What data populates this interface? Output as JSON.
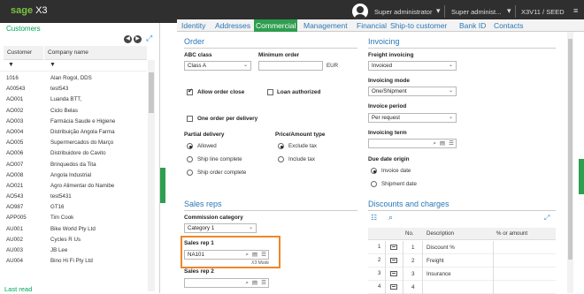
{
  "topbar": {
    "logo_brand": "sage",
    "logo_product": "X3",
    "user_name": "Super administrator",
    "role": "Super administ...",
    "endpoint": "X3V11 / SEED",
    "icons": [
      "user-avatar-icon",
      "caret-down-icon",
      "caret-down-icon",
      "hamburger-menu-icon"
    ]
  },
  "left_panel": {
    "title": "Customers",
    "columns": [
      "Customer",
      "Company name"
    ],
    "rows": [
      {
        "code": "1016",
        "name": "Alan Rogol, DDS"
      },
      {
        "code": "A00543",
        "name": "test543"
      },
      {
        "code": "AO001",
        "name": "Luanda BTT,"
      },
      {
        "code": "AO002",
        "name": "Ciclo Belas"
      },
      {
        "code": "AO003",
        "name": "Farmácia Saude e Higiene"
      },
      {
        "code": "AO004",
        "name": "Distribuição Angola Farma"
      },
      {
        "code": "AO005",
        "name": "Supermercados do Março"
      },
      {
        "code": "AO006",
        "name": "Distribuidore do Cavito"
      },
      {
        "code": "AO007",
        "name": "Brinquedos da Tita"
      },
      {
        "code": "AO008",
        "name": "Angola Industrial"
      },
      {
        "code": "AO021",
        "name": "Agro Alimentar do Namibe"
      },
      {
        "code": "AO543",
        "name": "test5431"
      },
      {
        "code": "AO987",
        "name": "GT16"
      },
      {
        "code": "APP005",
        "name": "Tim Cook"
      },
      {
        "code": "AU001",
        "name": "Bike World Pty Ltd"
      },
      {
        "code": "AU002",
        "name": "Cycles R Us"
      },
      {
        "code": "AU003",
        "name": "JB Lee"
      },
      {
        "code": "AU004",
        "name": "Bino Hi Fi Pty Ltd"
      }
    ],
    "last_read": "Last read"
  },
  "tabs": [
    "Identity",
    "Addresses",
    "Commercial",
    "Management",
    "Financial",
    "Ship-to customer",
    "Bank ID",
    "Contacts"
  ],
  "active_tab": "Commercial",
  "order": {
    "title": "Order",
    "abc_label": "ABC class",
    "abc_value": "Class A",
    "min_order_label": "Minimum order",
    "min_order_value": "",
    "currency": "EUR",
    "allow_close": "Allow order close",
    "allow_close_checked": true,
    "loan_authorized": "Loan authorized",
    "loan_checked": false,
    "one_order": "One order per delivery",
    "one_order_checked": false,
    "partial_label": "Partial delivery",
    "partial_options": [
      "Allowed",
      "Ship line complete",
      "Ship order complete"
    ],
    "partial_selected": "Allowed",
    "price_label": "Price/Amount type",
    "price_options": [
      "Exclude tax",
      "Include tax"
    ],
    "price_selected": "Exclude tax"
  },
  "invoicing": {
    "title": "Invoicing",
    "freight_label": "Freight invoicing",
    "freight_value": "Invoiced",
    "mode_label": "Invoicing mode",
    "mode_value": "One/Shipment",
    "period_label": "Invoice period",
    "period_value": "Per request",
    "term_label": "Invoicing term",
    "term_value": "",
    "due_label": "Due date origin",
    "due_options": [
      "Invoice date",
      "Shipment date"
    ],
    "due_selected": "Invoice date"
  },
  "sales_reps": {
    "title": "Sales reps",
    "commission_label": "Commission category",
    "commission_value": "Category 1",
    "rep1_label": "Sales rep 1",
    "rep1_value": "NA101",
    "x3_mode": "X3 Mode",
    "rep2_label": "Sales rep 2",
    "rep2_value": ""
  },
  "discounts": {
    "title": "Discounts and charges",
    "columns": [
      "No.",
      "Description",
      "% or amount"
    ],
    "rows": [
      {
        "line": "1",
        "no": "1",
        "description": "Discount %",
        "amount": ""
      },
      {
        "line": "2",
        "no": "2",
        "description": "Freight",
        "amount": ""
      },
      {
        "line": "3",
        "no": "3",
        "description": "Insurance",
        "amount": ""
      },
      {
        "line": "4",
        "no": "4",
        "description": "",
        "amount": ""
      }
    ]
  },
  "colors": {
    "brand_green": "#7cc242",
    "tab_green": "#2e9e4f",
    "link_blue": "#2a78b7",
    "highlight_orange": "#f0862a"
  }
}
